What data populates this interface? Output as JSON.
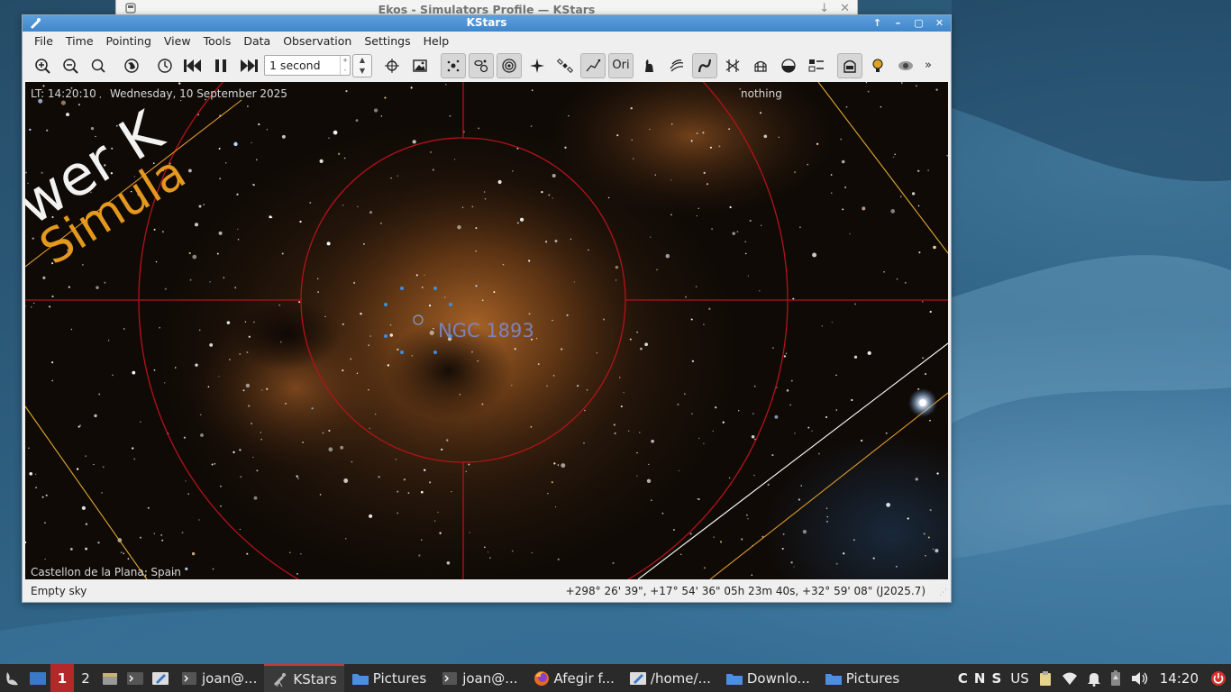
{
  "ekos_window": {
    "title": "Ekos - Simulators Profile — KStars"
  },
  "kstars_window": {
    "title": "KStars"
  },
  "menu": {
    "items": [
      {
        "label": "File"
      },
      {
        "label": "Time"
      },
      {
        "label": "Pointing"
      },
      {
        "label": "View"
      },
      {
        "label": "Tools"
      },
      {
        "label": "Data"
      },
      {
        "label": "Observation"
      },
      {
        "label": "Settings"
      },
      {
        "label": "Help"
      }
    ]
  },
  "toolbar": {
    "timestep_value": "1 second"
  },
  "skymap": {
    "local_time": "LT: 14:20:10",
    "date": "Wednesday, 10 September 2025",
    "focus_object": "nothing",
    "location": "Castellon de la Plana, Spain",
    "object_label": "NGC 1893",
    "watermark_text": "wer K Simula"
  },
  "statusbar": {
    "left": "Empty sky",
    "coords": "+298° 26' 39\", +17° 54' 36\"  05h 23m 40s, +32° 59' 08\" (J2025.7)"
  },
  "taskbar": {
    "workspaces": [
      "1",
      "2"
    ],
    "tasks": [
      {
        "label": "joan@..."
      },
      {
        "label": "KStars"
      },
      {
        "label": "Pictures"
      },
      {
        "label": "joan@..."
      },
      {
        "label": "Afegir f..."
      },
      {
        "label": "/home/..."
      },
      {
        "label": "Downlo..."
      },
      {
        "label": "Pictures"
      }
    ],
    "indicators": [
      "C",
      "N",
      "S"
    ],
    "keyboard_layout": "US",
    "clock": "14:20"
  },
  "colors": {
    "titlebar_active": "#3e86cb",
    "reticle_red": "#b4121a",
    "label_blue": "#7f86c4",
    "taskbar_bg": "#2a2a2a",
    "workspace_active": "#b32828"
  }
}
